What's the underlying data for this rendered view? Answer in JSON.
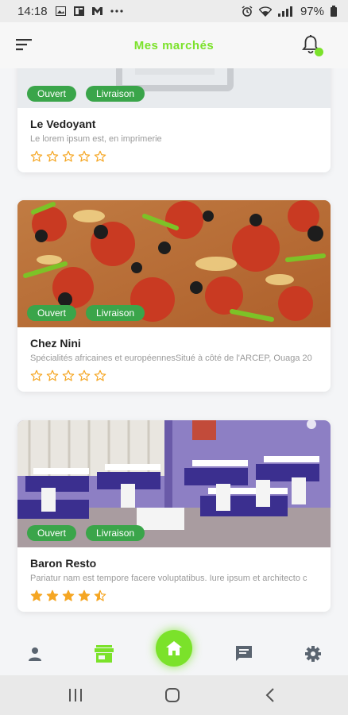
{
  "status_bar": {
    "time": "14:18",
    "notif_icons": [
      "image-icon",
      "news-icon",
      "mail-icon",
      "more-icon"
    ],
    "battery": "97%"
  },
  "app_bar": {
    "title": "Mes marchés"
  },
  "markets": [
    {
      "name": "Le Vedoyant",
      "description": "Le lorem ipsum est, en imprimerie",
      "badges": [
        "Ouvert",
        "Livraison"
      ],
      "rating": 0
    },
    {
      "name": "Chez Nini",
      "description": "Spécialités africaines et européennesSitué à côté de l'ARCEP, Ouaga 20",
      "badges": [
        "Ouvert",
        "Livraison"
      ],
      "rating": 0
    },
    {
      "name": "Baron Resto",
      "description": "Pariatur nam est tempore facere voluptatibus. Iure ipsum et architecto c",
      "badges": [
        "Ouvert",
        "Livraison"
      ],
      "rating": 4.5
    }
  ],
  "colors": {
    "accent": "#7be22a",
    "badge": "#3aa54a",
    "star": "#f5a623"
  },
  "bottom_nav": [
    "profile-icon",
    "store-icon",
    "home-icon",
    "chat-icon",
    "settings-icon"
  ]
}
